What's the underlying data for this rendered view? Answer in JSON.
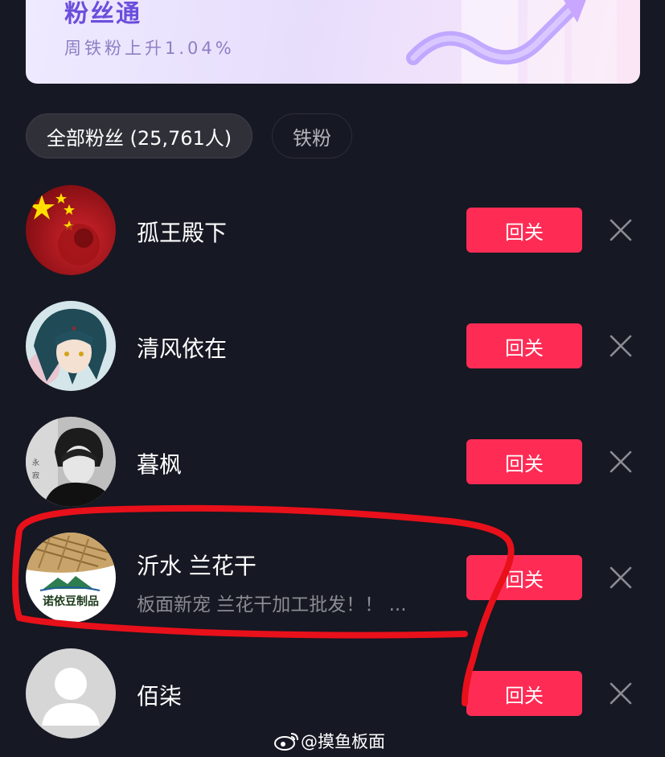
{
  "banner": {
    "title": "粉丝通",
    "subtitle": "周铁粉上升1.04%"
  },
  "tabs": [
    {
      "label": "全部粉丝 (25,761人)",
      "active": true
    },
    {
      "label": "铁粉",
      "active": false
    }
  ],
  "followers": [
    {
      "name": "孤王殿下",
      "subtitle": "",
      "button": "回关"
    },
    {
      "name": "清风依在",
      "subtitle": "",
      "button": "回关"
    },
    {
      "name": "暮枫",
      "subtitle": "",
      "button": "回关"
    },
    {
      "name": "沂水 兰花干",
      "subtitle": "板面新宠  兰花干加工批发！！ ...",
      "button": "回关",
      "avatar_text": "诺依豆制品"
    },
    {
      "name": "佰柒",
      "subtitle": "",
      "button": "回关"
    }
  ],
  "watermark": "@摸鱼板面",
  "colors": {
    "background": "#161823",
    "accent": "#fe2c55",
    "annotation": "#e8101a"
  },
  "icons": {
    "dismiss": "close-icon",
    "watermark": "weibo-icon"
  }
}
